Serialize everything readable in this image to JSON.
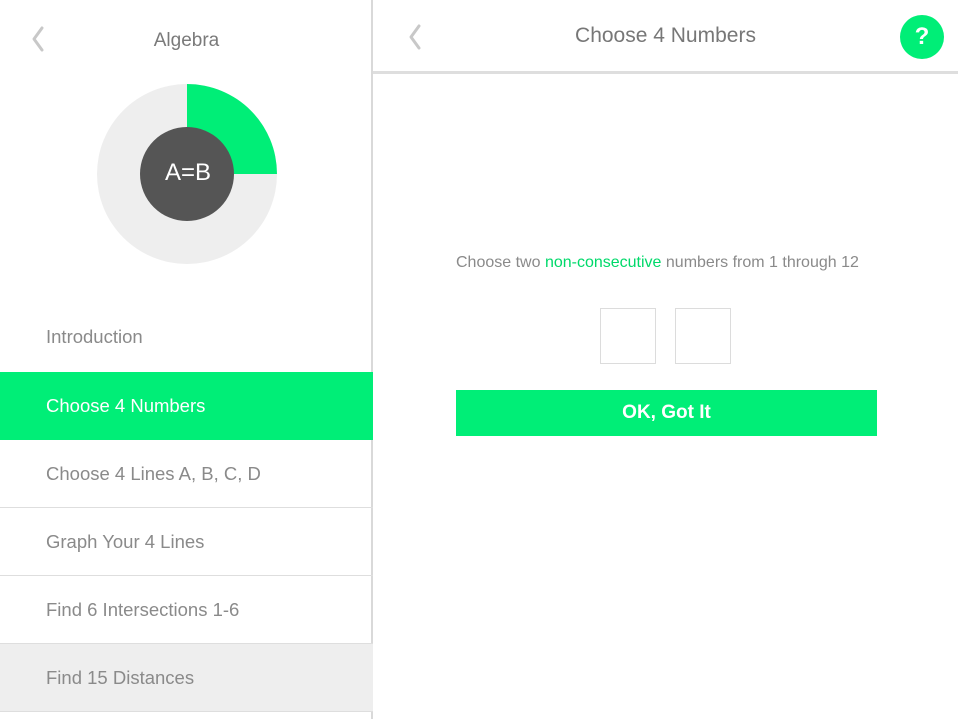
{
  "sidebar": {
    "title": "Algebra",
    "back_icon": "chevron-left-icon",
    "progress": {
      "fraction": 0.25,
      "label": "A=B",
      "colors": {
        "fill": "#00ee77",
        "track": "#eeeeee",
        "center": "#555555"
      }
    },
    "items": [
      {
        "label": "Introduction"
      },
      {
        "label": "Choose 4 Numbers"
      },
      {
        "label": "Choose 4 Lines A, B, C, D"
      },
      {
        "label": "Graph Your 4 Lines"
      },
      {
        "label": "Find 6 Intersections 1-6"
      },
      {
        "label": "Find 15 Distances"
      }
    ],
    "active_index": 1
  },
  "header": {
    "title": "Choose 4 Numbers",
    "back_icon": "chevron-left-icon",
    "help_label": "?"
  },
  "content": {
    "instruction_before": "Choose two ",
    "instruction_highlight": "non-consecutive",
    "instruction_after": " numbers from 1 through 12",
    "inputs": [
      "",
      ""
    ],
    "ok_label": "OK, Got It"
  },
  "colors": {
    "accent": "#00ee77",
    "text": "#8a8a8a"
  }
}
